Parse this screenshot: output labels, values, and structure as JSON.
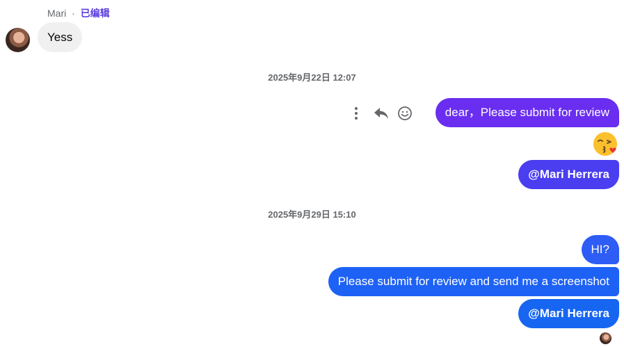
{
  "incoming": {
    "sender": "Mari",
    "separator": "·",
    "edited_label": "已编辑",
    "message": "Yess"
  },
  "timestamps": {
    "first": "2025年9月22日 12:07",
    "second": "2025年9月29日 15:10"
  },
  "message_actions": {
    "more": "more-vertical-icon",
    "reply": "reply-icon",
    "react": "smiley-icon"
  },
  "outgoing": {
    "msg1": "dear，Please submit for review",
    "msg2_emoji": "kiss-emoji",
    "msg3": "@Mari Herrera",
    "msg4": "HI?",
    "msg5": "Please submit for review and send me a screenshot",
    "msg6": "@Mari Herrera"
  },
  "colors": {
    "bubble_purple": "#6a2ef0",
    "bubble_indigo": "#4a3ef0",
    "bubble_blue": "#1e62f5",
    "edited_accent": "#5b3ee0",
    "incoming_bubble": "#f0f0f0"
  }
}
